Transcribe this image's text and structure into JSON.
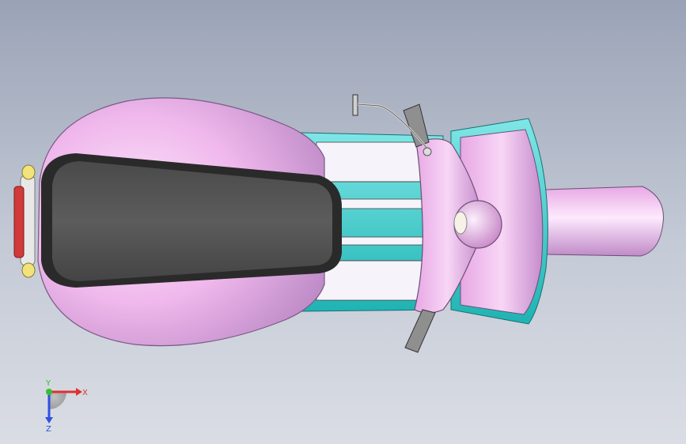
{
  "viewport": {
    "background_top": "#9aa3b6",
    "background_bottom": "#dadde4"
  },
  "model": {
    "description_icon": "scooter-top-view",
    "colors": {
      "body": "#f0b8ec",
      "body_shadow": "#b987c4",
      "seat": "#555555",
      "seat_edge": "#2a2a2a",
      "frame_teal": "#3fcfcf",
      "floor_white": "#f6f4fa",
      "chrome": "#e8e8e8",
      "tail_light": "#d23a3a",
      "indicator": "#f2e27a",
      "grip": "#8f8f8f"
    }
  },
  "triad": {
    "x_label": "X",
    "y_label": "Y",
    "z_label": "Z",
    "x_color": "#e03030",
    "y_color": "#30c030",
    "z_color": "#3050e0"
  }
}
